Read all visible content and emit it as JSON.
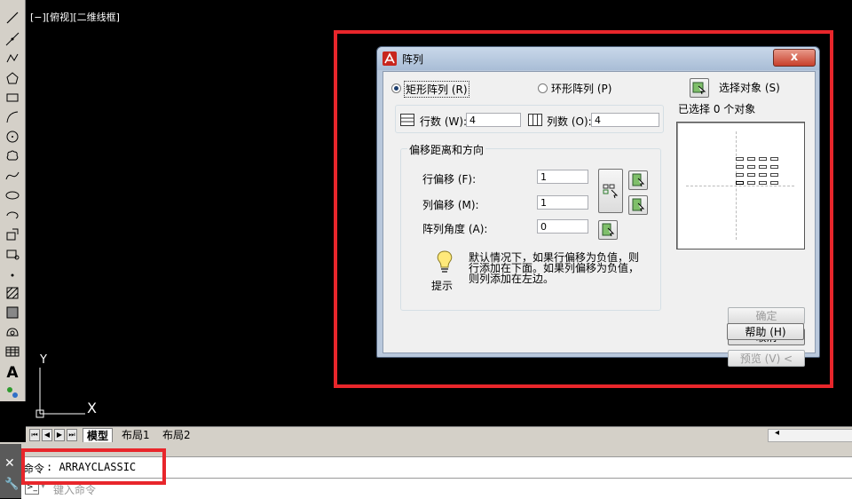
{
  "viewport": {
    "label": "[−][俯视][二维线框]"
  },
  "ucs": {
    "x_axis": "X",
    "y_axis": "Y"
  },
  "layout_tabs": [
    "模型",
    "布局1",
    "布局2"
  ],
  "command": {
    "prompt": "命令",
    "history": ": ARRAYCLASSIC",
    "input_placeholder": "键入命令"
  },
  "dialog": {
    "title": "阵列",
    "close": "x",
    "rect_array": "矩形阵列 (R)",
    "polar_array": "环形阵列 (P)",
    "rows_label": "行数 (W):",
    "rows_value": "4",
    "cols_label": "列数 (O):",
    "cols_value": "4",
    "offset_group": "偏移距离和方向",
    "row_offset_label": "行偏移 (F):",
    "row_offset_value": "1",
    "col_offset_label": "列偏移 (M):",
    "col_offset_value": "1",
    "angle_label": "阵列角度 (A):",
    "angle_value": "0",
    "tip_label": "提示",
    "tip_line1": "默认情况下，如果行偏移为负值，则",
    "tip_line2": "行添加在下面。如果列偏移为负值，",
    "tip_line3": "则列添加在左边。",
    "select_objects": "选择对象 (S)",
    "selected_count": "已选择 0 个对象",
    "ok": "确定",
    "cancel": "取消",
    "preview": "预览 (V) <",
    "help": "帮助 (H)"
  },
  "colors": {
    "highlight": "#e8262b",
    "canvas": "#000000",
    "dialog_face": "#f0f0f0"
  }
}
